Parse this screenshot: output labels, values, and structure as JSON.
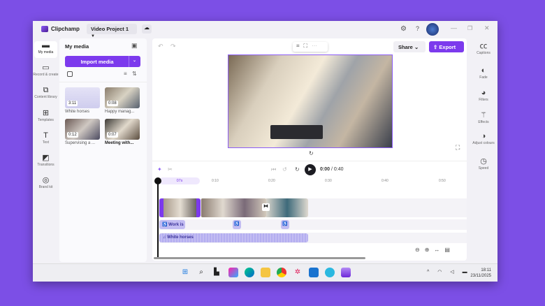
{
  "app": {
    "title": "Clipchamp",
    "project": "Video Project 1"
  },
  "nav": [
    {
      "label": "My media",
      "icon": "folder-icon"
    },
    {
      "label": "Record & create",
      "icon": "camera-icon"
    },
    {
      "label": "Content library",
      "icon": "library-icon"
    },
    {
      "label": "Templates",
      "icon": "templates-icon"
    },
    {
      "label": "Text",
      "icon": "text-icon"
    },
    {
      "label": "Transitions",
      "icon": "transitions-icon"
    },
    {
      "label": "Brand kit",
      "icon": "brand-kit-icon"
    }
  ],
  "media": {
    "title": "My media",
    "import_label": "Import media",
    "items": [
      {
        "name": "White horses",
        "duration": "3:11"
      },
      {
        "name": "Happy manag...",
        "duration": "0:08"
      },
      {
        "name": "Supervising a ...",
        "duration": "0:12"
      },
      {
        "name": "Meeting with...",
        "duration": "0:07"
      }
    ]
  },
  "toolbar": {
    "share": "Share",
    "export": "Export"
  },
  "playback": {
    "current": "0:00",
    "total": "/ 0:40"
  },
  "timeline": {
    "playhead_label": "07s",
    "ticks": [
      "0:10",
      "0:20",
      "0:30",
      "0:40",
      "0:50"
    ],
    "voice_label": "Work is",
    "audio_label": "White horses"
  },
  "right_panel": [
    {
      "label": "Captions"
    },
    {
      "label": "Fade"
    },
    {
      "label": "Filters"
    },
    {
      "label": "Effects"
    },
    {
      "label": "Adjust colours"
    },
    {
      "label": "Speed"
    }
  ],
  "taskbar": {
    "time": "18:11",
    "date": "23/11/2025"
  },
  "colors": {
    "accent": "#7c3aed",
    "background": "#7c4fe6"
  }
}
